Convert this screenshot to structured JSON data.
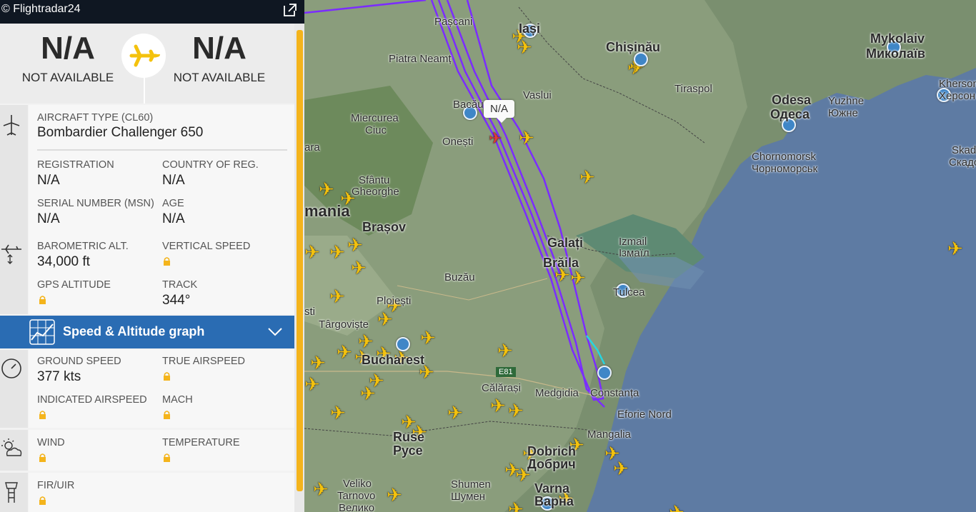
{
  "header": {
    "brand": "© Flightradar24"
  },
  "route": {
    "origin_code": "N/A",
    "origin_name": "NOT AVAILABLE",
    "destination_code": "N/A",
    "destination_name": "NOT AVAILABLE"
  },
  "aircraft": {
    "type_label": "AIRCRAFT TYPE (CL60)",
    "type_value": "Bombardier Challenger 650",
    "registration_label": "REGISTRATION",
    "registration_value": "N/A",
    "country_label": "COUNTRY OF REG.",
    "country_value": "N/A",
    "serial_label": "SERIAL NUMBER (MSN)",
    "serial_value": "N/A",
    "age_label": "AGE",
    "age_value": "N/A"
  },
  "altitude": {
    "baro_label": "BAROMETRIC ALT.",
    "baro_value": "34,000 ft",
    "vs_label": "VERTICAL SPEED",
    "gps_label": "GPS ALTITUDE",
    "track_label": "TRACK",
    "track_value": "344°"
  },
  "graph": {
    "title": "Speed & Altitude graph"
  },
  "speed": {
    "ground_label": "GROUND SPEED",
    "ground_value": "377 kts",
    "tas_label": "TRUE AIRSPEED",
    "ias_label": "INDICATED AIRSPEED",
    "mach_label": "MACH"
  },
  "weather": {
    "wind_label": "WIND",
    "temp_label": "TEMPERATURE"
  },
  "fir": {
    "label": "FIR/UIR"
  },
  "map": {
    "callout": "N/A",
    "cities": [
      "Pașcani",
      "Iași",
      "Chișinău",
      "Mykolaiv",
      "Миколаїв",
      "Piatra Neamț",
      "Vaslui",
      "Tiraspol",
      "Odesa",
      "Одеса",
      "Yuzhne",
      "Южне",
      "Kherson",
      "Херсон",
      "Bacău",
      "Miercurea",
      "Ciuc",
      "Onești",
      "Chornomorsk",
      "Чорноморськ",
      "Skad",
      "Скадо",
      "Sfântu",
      "Gheorghe",
      "mania",
      "Brașov",
      "Galați",
      "Izmail",
      "Ізмаїл",
      "Brăila",
      "Buzău",
      "Tulcea",
      "Ploiești",
      "Târgoviște",
      "sti",
      "Bucharest",
      "Călărași",
      "Medgidia",
      "Constanța",
      "Eforie Nord",
      "Mangalia",
      "Ruse",
      "Русе",
      "Dobrich",
      "Добрич",
      "Veliko",
      "Tarnovo",
      "Велико",
      "Shumen",
      "Шумен",
      "Varna",
      "Варна",
      "ara",
      "E81"
    ]
  },
  "colors": {
    "accent": "#f4b41c",
    "graphbar": "#2a6cb3",
    "track": "#7b2cff",
    "plane": "#f4c20d",
    "sea": "#5e7ba3"
  }
}
